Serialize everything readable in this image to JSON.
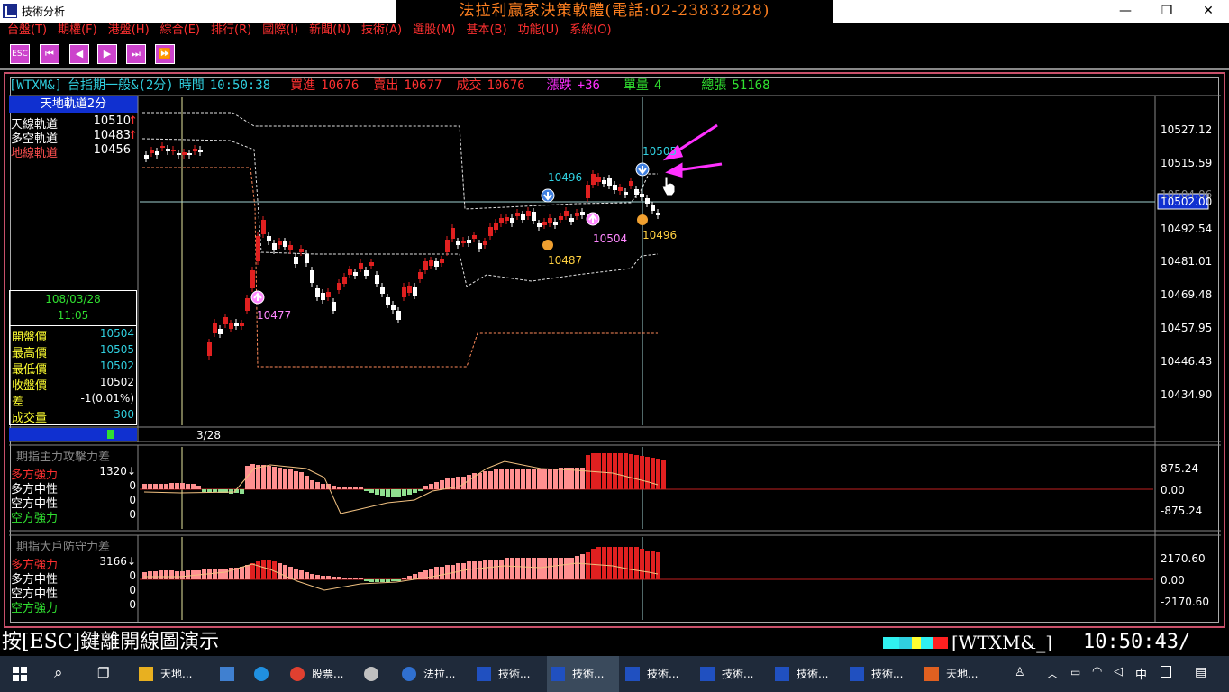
{
  "window": {
    "title": "技術分析",
    "banner": "法拉利贏家決策軟體(電話:02-23832828)",
    "btn_min": "—",
    "btn_max": "❐",
    "btn_close": "✕"
  },
  "menu": [
    "台盤(T)",
    "期權(F)",
    "港盤(H)",
    "綜合(E)",
    "排行(R)",
    "國際(I)",
    "新聞(N)",
    "技術(A)",
    "選股(M)",
    "基本(B)",
    "功能(U)",
    "系統(O)"
  ],
  "toolbar": {
    "esc_label": "ESC"
  },
  "info": {
    "symbol": "[WTXM&]",
    "name": "台指期一般&(2分)",
    "time_label": "時間",
    "time": "10:50:38",
    "bid_label": "買進",
    "bid": "10676",
    "ask_label": "賣出",
    "ask": "10677",
    "trade_label": "成交",
    "trade": "10676",
    "change_label": "漲跌",
    "change": "+36",
    "vol_label": "單量",
    "vol": "4",
    "total_label": "總張",
    "total": "51168"
  },
  "legend_main": {
    "title": "天地軌道2分",
    "rows": [
      {
        "label": "天線軌道",
        "value": "10510",
        "arrow": "↑"
      },
      {
        "label": "多空軌道",
        "value": "10483",
        "arrow": "↑"
      },
      {
        "label": "地線軌道",
        "value": "10456",
        "arrow": ""
      }
    ]
  },
  "quote_panel": {
    "date": "108/03/28",
    "time": "11:05",
    "rows": [
      {
        "label": "開盤價",
        "value": "10504"
      },
      {
        "label": "最高價",
        "value": "10505"
      },
      {
        "label": "最低價",
        "value": "10502"
      },
      {
        "label": "收盤價",
        "value": "10502"
      },
      {
        "label": "差",
        "value": "-1(0.01%)"
      },
      {
        "label": "成交量",
        "value": "300"
      }
    ]
  },
  "main_axis": [
    "10527.12",
    "10515.59",
    "10504.06",
    "10492.54",
    "10481.01",
    "10469.48",
    "10457.95",
    "10446.43",
    "10434.90"
  ],
  "current_price_tag": "10502.00",
  "x_date": "3/28",
  "markers": [
    {
      "text": "10477",
      "type": "buy"
    },
    {
      "text": "10496",
      "type": "sell"
    },
    {
      "text": "10487",
      "type": "dot"
    },
    {
      "text": "10504",
      "type": "buy"
    },
    {
      "text": "10505",
      "type": "sell"
    },
    {
      "text": "10496",
      "type": "dot"
    }
  ],
  "sub1": {
    "title": "期指主力攻擊力差",
    "rows": [
      {
        "label": "多方強力",
        "value": "1320↓"
      },
      {
        "label": "多方中性",
        "value": "0"
      },
      {
        "label": "空方中性",
        "value": "0"
      },
      {
        "label": "空方強力",
        "value": "0"
      }
    ],
    "axis": [
      "875.24",
      "0.00",
      "-875.24"
    ]
  },
  "sub2": {
    "title": "期指大戶防守力差",
    "rows": [
      {
        "label": "多方強力",
        "value": "3166↓"
      },
      {
        "label": "多方中性",
        "value": "0"
      },
      {
        "label": "空方中性",
        "value": "0"
      },
      {
        "label": "空方強力",
        "value": "0"
      }
    ],
    "axis": [
      "2170.60",
      "0.00",
      "-2170.60"
    ]
  },
  "status": {
    "hint": "按[ESC]鍵離開線圖演示",
    "symbol": "[WTXM&_]",
    "clock": "10:50:43/"
  },
  "taskbar": {
    "items": [
      {
        "label": "天地..."
      },
      {
        "label": ""
      },
      {
        "label": ""
      },
      {
        "label": "股票..."
      },
      {
        "label": ""
      },
      {
        "label": "法拉..."
      },
      {
        "label": "技術..."
      },
      {
        "label": "技術..."
      },
      {
        "label": "技術..."
      },
      {
        "label": "技術..."
      },
      {
        "label": "技術..."
      },
      {
        "label": "技術..."
      },
      {
        "label": "天地..."
      }
    ],
    "lang": "中"
  },
  "colors": {
    "up": "#e02020",
    "down": "#ffffff",
    "orbit": "#ffffff",
    "ground": "#ff8a5a",
    "axis_text": "#ffffff",
    "cyan": "#30d0e0"
  }
}
